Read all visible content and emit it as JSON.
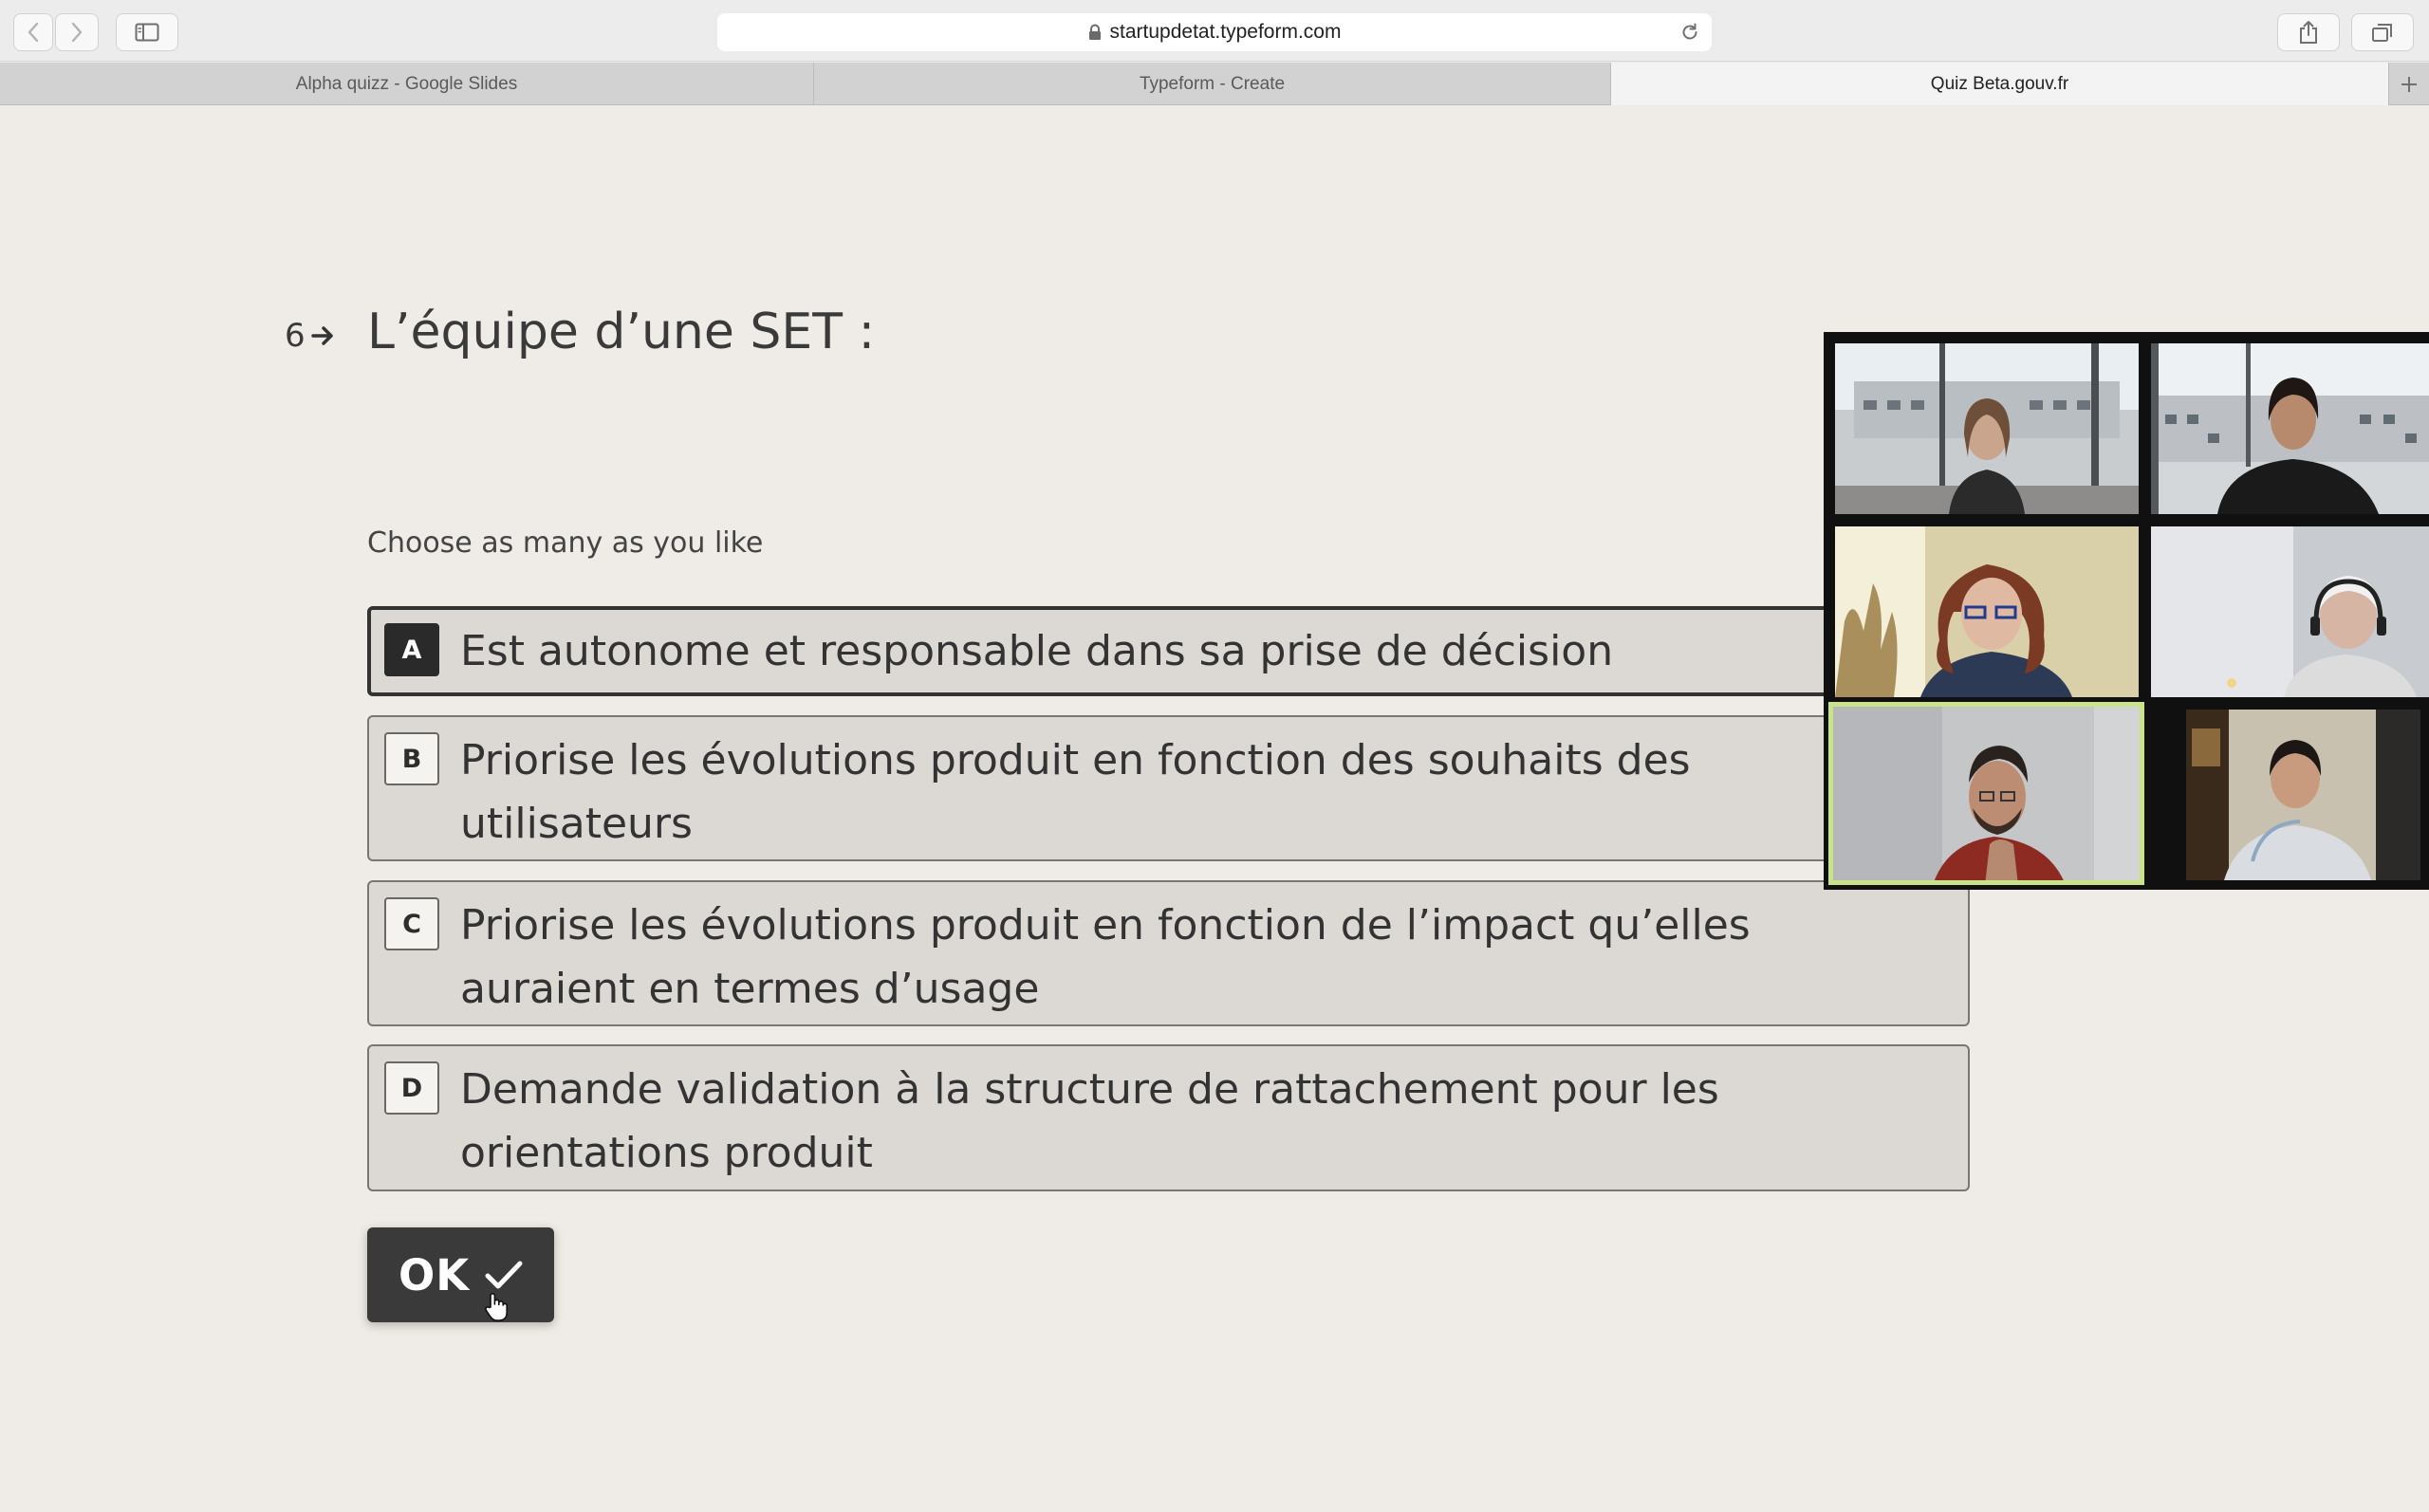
{
  "browser": {
    "url": "startupdetat.typeform.com",
    "tabs": [
      {
        "label": "Alpha quizz - Google Slides",
        "active": false
      },
      {
        "label": "Typeform - Create",
        "active": false
      },
      {
        "label": "Quiz Beta.gouv.fr",
        "active": true
      }
    ],
    "icons": [
      "back-icon",
      "forward-icon",
      "sidebar-icon",
      "lock-icon",
      "reload-icon",
      "share-icon",
      "tabs-overview-icon",
      "new-tab-icon"
    ]
  },
  "question": {
    "number": "6",
    "title": "L’équipe d’une SET :",
    "hint": "Choose as many as you like",
    "choices": [
      {
        "key": "A",
        "label": "Est autonome et responsable dans sa prise de décision",
        "selected": true
      },
      {
        "key": "B",
        "label": "Priorise les évolutions produit en fonction des souhaits des utilisateurs",
        "selected": false
      },
      {
        "key": "C",
        "label": "Priorise les évolutions produit en fonction de l’impact qu’elles auraient en termes d’usage",
        "selected": false
      },
      {
        "key": "D",
        "label": "Demande validation à la structure de rattachement pour les orientations produit",
        "selected": false
      }
    ],
    "submit_label": "OK"
  },
  "video_call": {
    "participants": 6,
    "active_speaker_tile": 5,
    "speaker_highlight_color": "#c9e38a"
  },
  "colors": {
    "page_background": "#efebe6",
    "choice_background": "#dcd8d4",
    "button_background": "#3a3a3a"
  }
}
